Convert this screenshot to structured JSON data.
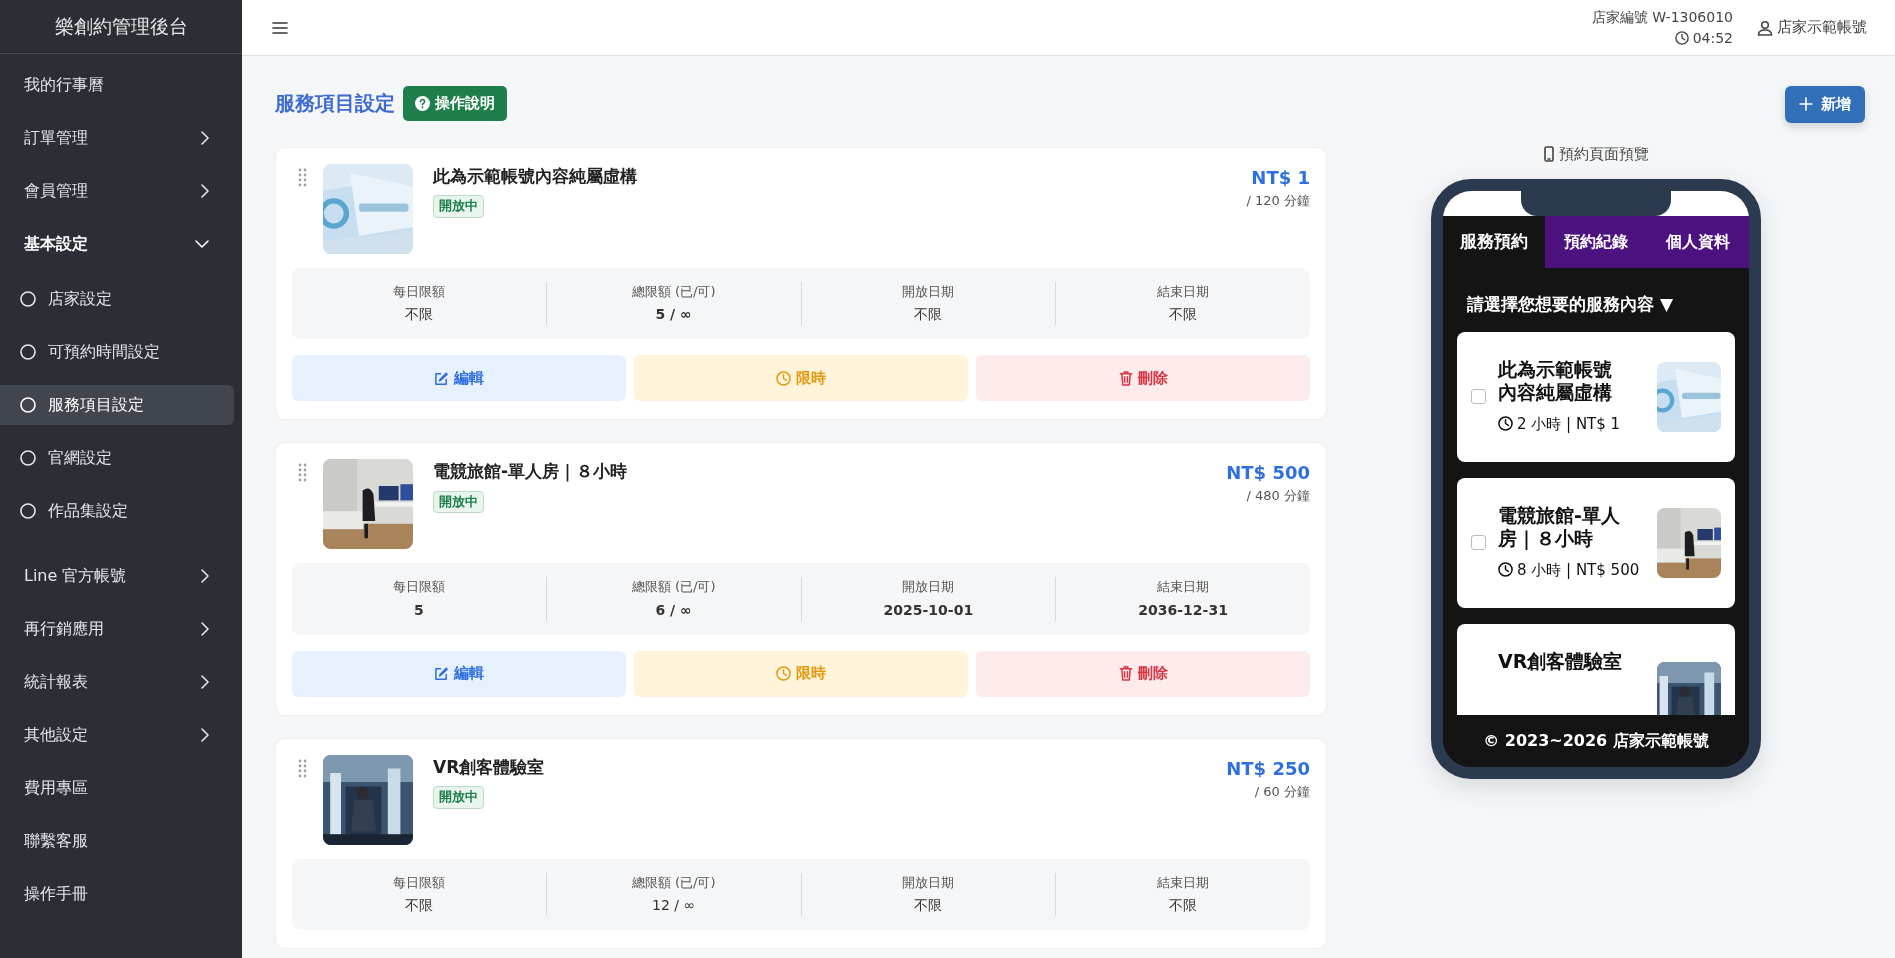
{
  "sidebar": {
    "title": "樂創約管理後台",
    "items": [
      {
        "label": "我的行事曆",
        "kind": "link",
        "selected": false
      },
      {
        "label": "訂單管理",
        "kind": "group",
        "expanded": false,
        "selected": false
      },
      {
        "label": "會員管理",
        "kind": "group",
        "expanded": false,
        "selected": false
      },
      {
        "label": "基本設定",
        "kind": "group",
        "expanded": true,
        "selected": false,
        "children": [
          {
            "label": "店家設定",
            "selected": false
          },
          {
            "label": "可預約時間設定",
            "selected": false
          },
          {
            "label": "服務項目設定",
            "selected": true
          },
          {
            "label": "官網設定",
            "selected": false
          },
          {
            "label": "作品集設定",
            "selected": false
          }
        ]
      },
      {
        "label": "Line 官方帳號",
        "kind": "group",
        "expanded": false,
        "selected": false
      },
      {
        "label": "再行銷應用",
        "kind": "group",
        "expanded": false,
        "selected": false
      },
      {
        "label": "統計報表",
        "kind": "group",
        "expanded": false,
        "selected": false
      },
      {
        "label": "其他設定",
        "kind": "group",
        "expanded": false,
        "selected": false
      },
      {
        "label": "費用專區",
        "kind": "link",
        "selected": false
      },
      {
        "label": "聯繫客服",
        "kind": "link",
        "selected": false
      },
      {
        "label": "操作手冊",
        "kind": "link",
        "selected": false
      }
    ]
  },
  "header": {
    "store_id": "店家編號 W-1306010",
    "time": "04:52",
    "user": "店家示範帳號"
  },
  "page": {
    "title": "服務項目設定",
    "help_button": "操作說明",
    "add_button": "新增",
    "preview_label": "預約頁面預覽"
  },
  "services": [
    {
      "name": "此為示範帳號內容純屬虛構",
      "status": "開放中",
      "price": "NT$ 1",
      "duration": "/ 120 分鐘",
      "stats": [
        {
          "label": "每日限額",
          "value": "不限"
        },
        {
          "label": "總限額 (已/可)",
          "value": "5 / ∞"
        },
        {
          "label": "開放日期",
          "value": "不限"
        },
        {
          "label": "結束日期",
          "value": "不限"
        }
      ],
      "buttons": [
        {
          "label": "編輯",
          "kind": "edit"
        },
        {
          "label": "限時",
          "kind": "timer"
        },
        {
          "label": "刪除",
          "kind": "delete"
        }
      ]
    },
    {
      "name": "電競旅館-單人房｜８小時",
      "status": "開放中",
      "price": "NT$ 500",
      "duration": "/ 480 分鐘",
      "stats": [
        {
          "label": "每日限額",
          "value": "5"
        },
        {
          "label": "總限額 (已/可)",
          "value": "6 / ∞"
        },
        {
          "label": "開放日期",
          "value": "2025-10-01"
        },
        {
          "label": "結束日期",
          "value": "2036-12-31"
        }
      ],
      "buttons": [
        {
          "label": "編輯",
          "kind": "edit"
        },
        {
          "label": "限時",
          "kind": "timer"
        },
        {
          "label": "刪除",
          "kind": "delete"
        }
      ]
    },
    {
      "name": "VR創客體驗室",
      "status": "開放中",
      "price": "NT$ 250",
      "duration": "/ 60 分鐘",
      "stats": [
        {
          "label": "每日限額",
          "value": "不限"
        },
        {
          "label": "總限額 (已/可)",
          "value": "12 / ∞"
        },
        {
          "label": "開放日期",
          "value": "不限"
        },
        {
          "label": "結束日期",
          "value": "不限"
        }
      ]
    }
  ],
  "phone": {
    "tabs": [
      {
        "label": "服務預約",
        "selected": true
      },
      {
        "label": "預約紀錄",
        "selected": false
      },
      {
        "label": "個人資料",
        "selected": false
      }
    ],
    "prompt": "請選擇您想要的服務內容 ▼",
    "items": [
      {
        "title": "此為示範帳號內容純屬虛構",
        "meta": "2 小時 | NT$ 1",
        "checked": false
      },
      {
        "title": "電競旅館-單人房｜８小時",
        "meta": "8 小時 | NT$ 500",
        "checked": false
      },
      {
        "title": "VR創客體驗室"
      }
    ],
    "footer": "© 2023~2026 店家示範帳號"
  }
}
